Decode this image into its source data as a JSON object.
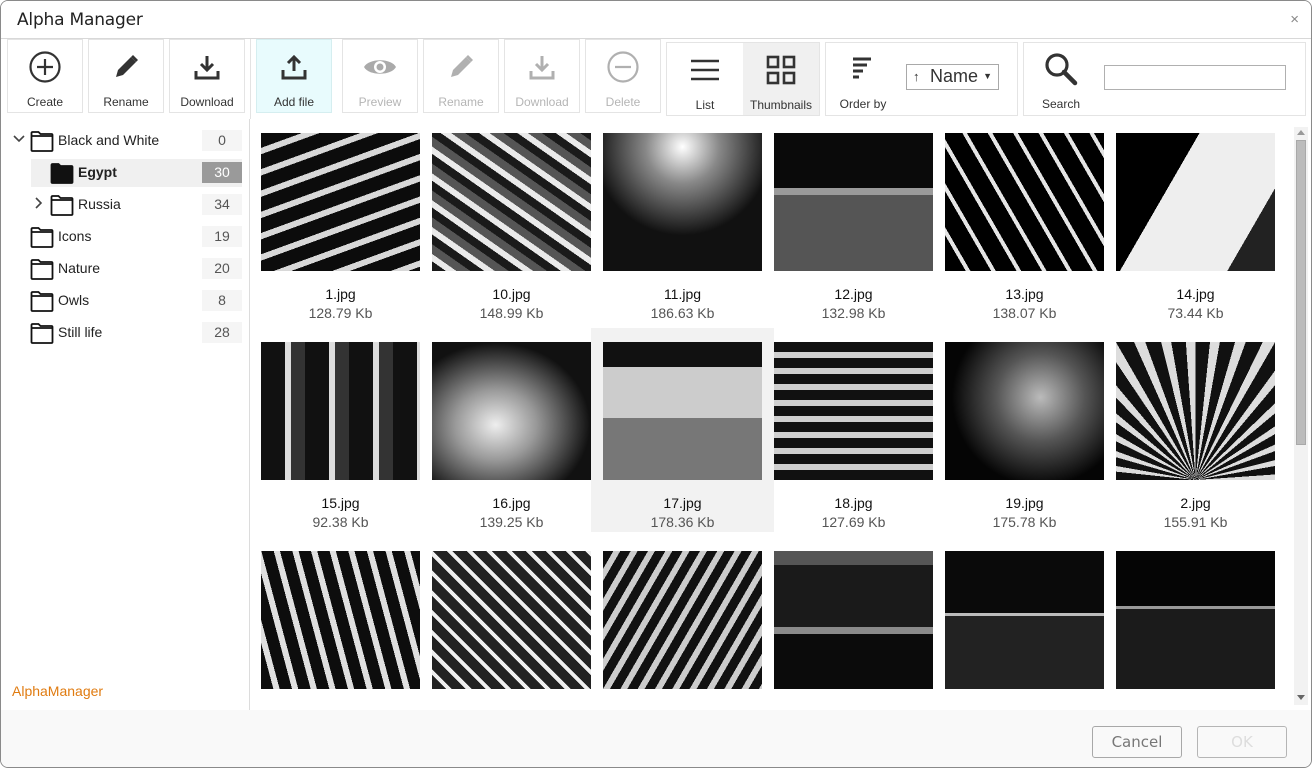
{
  "window": {
    "title": "Alpha Manager",
    "close_label": "×"
  },
  "toolbar": {
    "folder_actions": [
      {
        "label": "Create",
        "icon": "plus-circle-icon",
        "enabled": true
      },
      {
        "label": "Rename",
        "icon": "pencil-icon",
        "enabled": true
      },
      {
        "label": "Download",
        "icon": "download-icon",
        "enabled": true
      }
    ],
    "file_actions": [
      {
        "label": "Add file",
        "icon": "upload-icon",
        "enabled": true,
        "highlighted": true
      },
      {
        "label": "Preview",
        "icon": "eye-icon",
        "enabled": false
      },
      {
        "label": "Rename",
        "icon": "pencil-icon",
        "enabled": false
      },
      {
        "label": "Download",
        "icon": "download-icon",
        "enabled": false
      },
      {
        "label": "Delete",
        "icon": "minus-circle-icon",
        "enabled": false
      }
    ],
    "view_modes": [
      {
        "label": "List",
        "icon": "list-icon",
        "selected": false
      },
      {
        "label": "Thumbnails",
        "icon": "grid-icon",
        "selected": true
      }
    ],
    "order_by": {
      "label": "Order by",
      "direction": "↑",
      "value": "Name",
      "caret": "▼"
    },
    "search": {
      "label": "Search",
      "value": "",
      "placeholder": ""
    }
  },
  "sidebar": {
    "tree": [
      {
        "name": "Black and White",
        "count": "0",
        "level": 0,
        "expander": "expanded",
        "selected": false
      },
      {
        "name": "Egypt",
        "count": "30",
        "level": 1,
        "expander": "none",
        "selected": true
      },
      {
        "name": "Russia",
        "count": "34",
        "level": 1,
        "expander": "collapsed",
        "selected": false
      },
      {
        "name": "Icons",
        "count": "19",
        "level": 0,
        "expander": "none",
        "selected": false
      },
      {
        "name": "Nature",
        "count": "20",
        "level": 0,
        "expander": "none",
        "selected": false
      },
      {
        "name": "Owls",
        "count": "8",
        "level": 0,
        "expander": "none",
        "selected": false
      },
      {
        "name": "Still life",
        "count": "28",
        "level": 0,
        "expander": "none",
        "selected": false
      }
    ],
    "brand": "AlphaManager",
    "brand_color": "#e07b10"
  },
  "files": [
    {
      "name": "1.jpg",
      "size": "128.79 Kb"
    },
    {
      "name": "10.jpg",
      "size": "148.99 Kb"
    },
    {
      "name": "11.jpg",
      "size": "186.63 Kb"
    },
    {
      "name": "12.jpg",
      "size": "132.98 Kb"
    },
    {
      "name": "13.jpg",
      "size": "138.07 Kb"
    },
    {
      "name": "14.jpg",
      "size": "73.44 Kb"
    },
    {
      "name": "15.jpg",
      "size": "92.38 Kb"
    },
    {
      "name": "16.jpg",
      "size": "139.25 Kb"
    },
    {
      "name": "17.jpg",
      "size": "178.36 Kb",
      "selected": true
    },
    {
      "name": "18.jpg",
      "size": "127.69 Kb"
    },
    {
      "name": "19.jpg",
      "size": "175.78 Kb"
    },
    {
      "name": "2.jpg",
      "size": "155.91 Kb"
    },
    {
      "name": "",
      "size": ""
    },
    {
      "name": "",
      "size": ""
    },
    {
      "name": "",
      "size": ""
    },
    {
      "name": "",
      "size": ""
    },
    {
      "name": "",
      "size": ""
    },
    {
      "name": "",
      "size": ""
    }
  ],
  "footer": {
    "cancel_label": "Cancel",
    "ok_label": "OK",
    "ok_enabled": false
  }
}
